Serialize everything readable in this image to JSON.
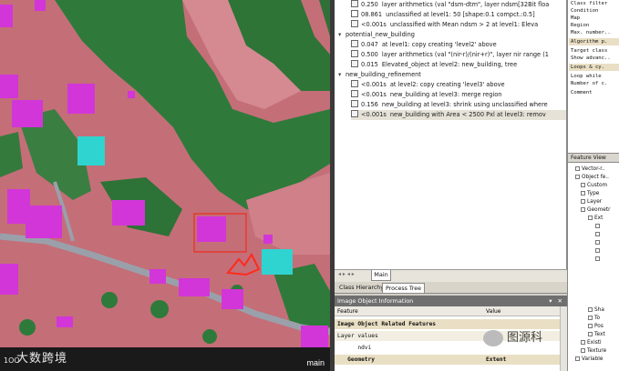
{
  "map": {
    "logo_mark": "1OO",
    "logo_text": "大数跨境",
    "viewer_label": "main"
  },
  "process_tree": {
    "rows": [
      {
        "time": "0.250",
        "text": "layer arithmetics (val \"dsm-dtm\", layer ndsm[32Bit floa"
      },
      {
        "time": "08.861",
        "text": "unclassified at  level1: 50 [shape:0.1 compct.:0.5]"
      },
      {
        "time": "<0.001s",
        "text": "unclassified with Mean ndsm > 2  at  level1: Eleva"
      },
      {
        "time": "",
        "text": "potential_new_building"
      },
      {
        "time": "0.047",
        "text": "at  level1: copy creating 'level2' above"
      },
      {
        "time": "0.500",
        "text": "layer arithmetics (val \"(nir-r)/(nir+r)\", layer nir range (1"
      },
      {
        "time": "0.015",
        "text": "Elevated_object at  level2: new_building, tree"
      },
      {
        "time": "",
        "text": "new_building_refinement"
      },
      {
        "time": "<0.001s",
        "text": "at  level2: copy creating 'level3' above"
      },
      {
        "time": "<0.001s",
        "text": "new_building at  level3: merge region"
      },
      {
        "time": "0.156",
        "text": "new_building at  level3: shrink using unclassified where"
      },
      {
        "time": "<0.001s",
        "text": "new_building with Area < 2500 Pxl at  level3: remov"
      }
    ],
    "bottom_tab": "Main"
  },
  "tabs": {
    "class_hierarchy": "Class Hierarchy",
    "process_tree": "Process Tree"
  },
  "image_object_info": {
    "title": "Image Object Information",
    "buttons": "▾ ✕",
    "col_feature": "Feature",
    "col_value": "Value",
    "rows": [
      {
        "feature": "Image Object Related Features",
        "value": "",
        "section": true
      },
      {
        "feature": "   Layer values",
        "value": "",
        "section": false
      },
      {
        "feature": "      ndvi",
        "value": "",
        "section": false
      },
      {
        "feature": "   Geometry",
        "value": "Extent",
        "section": true
      }
    ]
  },
  "right_panel": {
    "top_lines": [
      "Class filter",
      "Condition",
      "Map",
      "Region",
      "Max. number..",
      "Algorithm p.",
      "Target class",
      "Show advanc..",
      "Loops & cy.",
      "Loop while",
      "Number of c.",
      "Comment"
    ],
    "feature_view": "Feature View",
    "features": [
      "Vector-r..",
      "Object fe..",
      "Custom",
      "Type",
      "Layer",
      "Geometr",
      "Ext",
      "",
      "",
      "",
      "",
      "",
      "Sha",
      "To",
      "Pos",
      "Text",
      "Existi",
      "Texture",
      "Variable"
    ]
  },
  "watermark": {
    "text": "图源科"
  }
}
